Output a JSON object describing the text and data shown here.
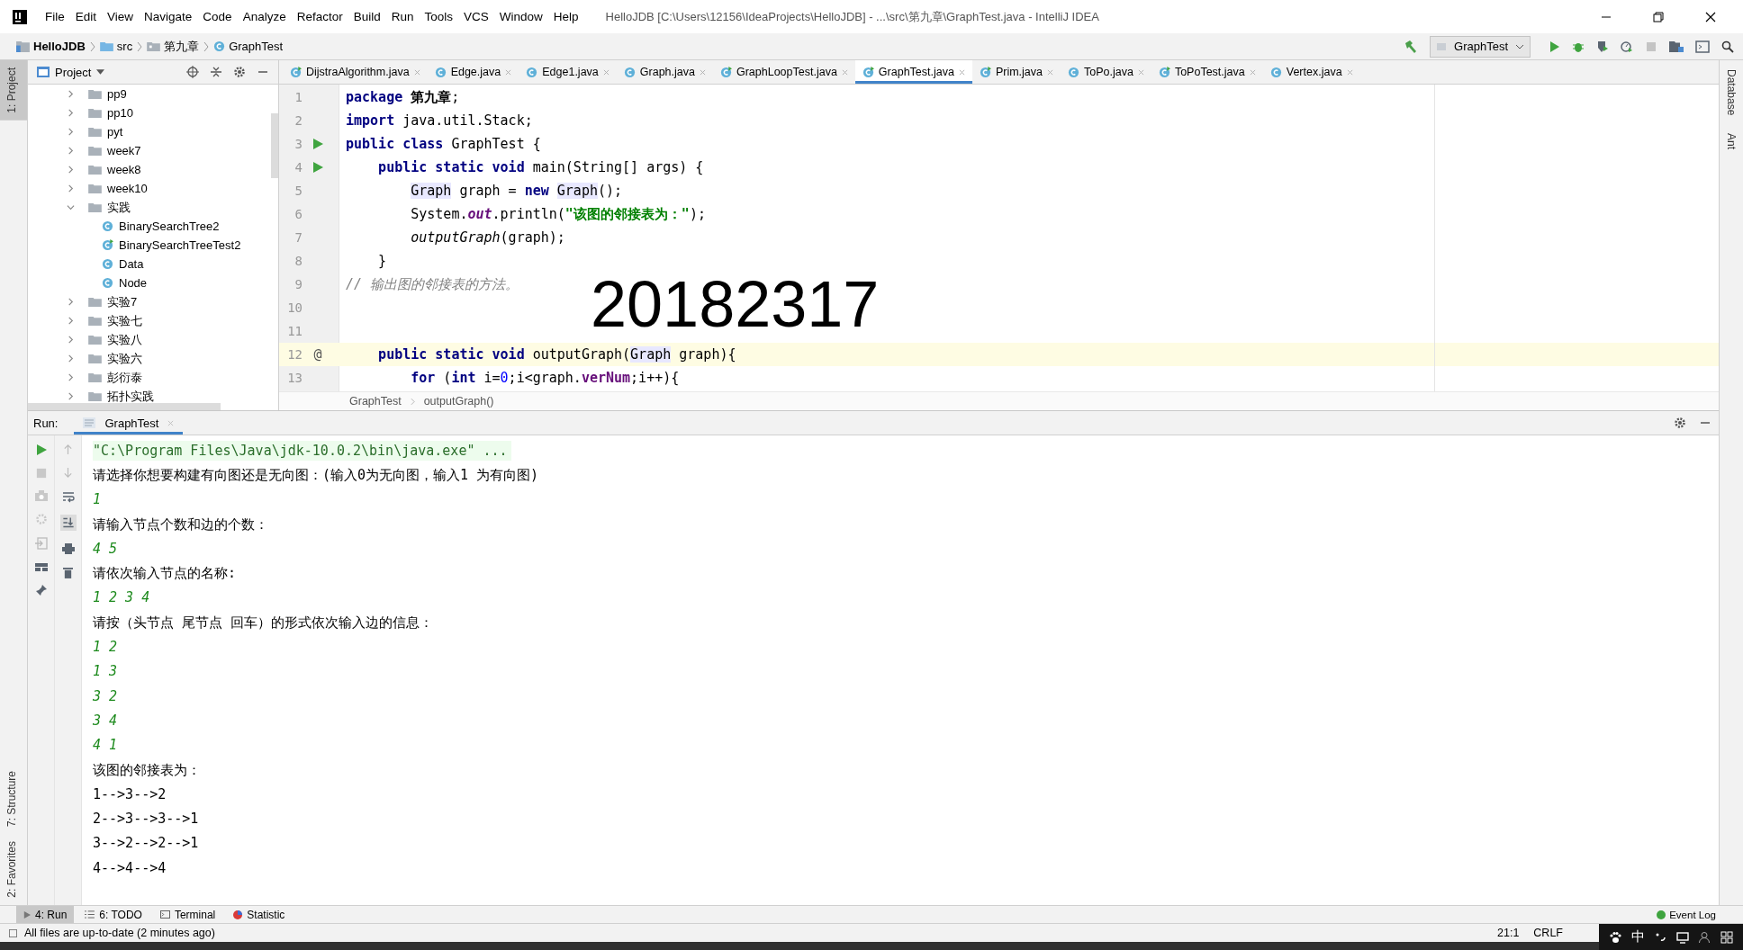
{
  "window": {
    "title": "HelloJDB [C:\\Users\\12156\\IdeaProjects\\HelloJDB] - ...\\src\\第九章\\GraphTest.java - IntelliJ IDEA"
  },
  "menu": [
    "File",
    "Edit",
    "View",
    "Navigate",
    "Code",
    "Analyze",
    "Refactor",
    "Build",
    "Run",
    "Tools",
    "VCS",
    "Window",
    "Help"
  ],
  "breadcrumb": [
    {
      "kind": "module",
      "label": "HelloJDB"
    },
    {
      "kind": "folder",
      "label": "src"
    },
    {
      "kind": "package",
      "label": "第九章"
    },
    {
      "kind": "class",
      "label": "GraphTest"
    }
  ],
  "run_config": "GraphTest",
  "left_top_tools": [
    {
      "label": "1: Project",
      "selected": true
    }
  ],
  "left_bottom_tools": [
    {
      "label": "7: Structure",
      "selected": false
    },
    {
      "label": "2: Favorites",
      "selected": false
    }
  ],
  "right_tools": [
    "Database",
    "Ant"
  ],
  "project": {
    "title": "Project",
    "tree": [
      {
        "label": "pp9",
        "kind": "folder",
        "expanded": false
      },
      {
        "label": "pp10",
        "kind": "folder",
        "expanded": false
      },
      {
        "label": "pyt",
        "kind": "folder",
        "expanded": false
      },
      {
        "label": "week7",
        "kind": "folder",
        "expanded": false
      },
      {
        "label": "week8",
        "kind": "folder",
        "expanded": false
      },
      {
        "label": "week10",
        "kind": "folder",
        "expanded": false
      },
      {
        "label": "实践",
        "kind": "folder",
        "expanded": true,
        "children": [
          {
            "label": "BinarySearchTree2",
            "kind": "class"
          },
          {
            "label": "BinarySearchTreeTest2",
            "kind": "test_class"
          },
          {
            "label": "Data",
            "kind": "class"
          },
          {
            "label": "Node",
            "kind": "class"
          }
        ]
      },
      {
        "label": "实验7",
        "kind": "folder",
        "expanded": false
      },
      {
        "label": "实验七",
        "kind": "folder",
        "expanded": false
      },
      {
        "label": "实验八",
        "kind": "folder",
        "expanded": false
      },
      {
        "label": "实验六",
        "kind": "folder",
        "expanded": false
      },
      {
        "label": "彭衍泰",
        "kind": "folder",
        "expanded": false
      },
      {
        "label": "拓扑实践",
        "kind": "folder",
        "expanded": false
      }
    ]
  },
  "editor_tabs": [
    {
      "label": "DijstraAlgorithm.java",
      "kind": "test_class",
      "selected": false
    },
    {
      "label": "Edge.java",
      "kind": "class",
      "selected": false
    },
    {
      "label": "Edge1.java",
      "kind": "class",
      "selected": false
    },
    {
      "label": "Graph.java",
      "kind": "class",
      "selected": false
    },
    {
      "label": "GraphLoopTest.java",
      "kind": "test_class",
      "selected": false
    },
    {
      "label": "GraphTest.java",
      "kind": "test_class",
      "selected": true
    },
    {
      "label": "Prim.java",
      "kind": "test_class",
      "selected": false
    },
    {
      "label": "ToPo.java",
      "kind": "class",
      "selected": false
    },
    {
      "label": "ToPoTest.java",
      "kind": "test_class",
      "selected": false
    },
    {
      "label": "Vertex.java",
      "kind": "class",
      "selected": false
    }
  ],
  "code": [
    {
      "number": "1",
      "kind": "top",
      "current": false,
      "segments": [
        {
          "kind": "kw",
          "text": "package "
        },
        {
          "kind": "bold",
          "text": "第九章"
        },
        {
          "kind": "plain",
          "text": ";"
        }
      ]
    },
    {
      "number": "2",
      "kind": "top",
      "current": false,
      "segments": [
        {
          "kind": "kw",
          "text": "import "
        },
        {
          "kind": "plain",
          "text": "java.util.Stack;"
        }
      ]
    },
    {
      "number": "3",
      "kind": "top",
      "current": false,
      "gutter": {
        "kind": "run"
      },
      "segments": [
        {
          "kind": "kw",
          "text": "public class "
        },
        {
          "kind": "plain",
          "text": "GraphTest {"
        }
      ]
    },
    {
      "number": "4",
      "kind": "member",
      "current": false,
      "gutter": {
        "kind": "run"
      },
      "segments": [
        {
          "kind": "kw",
          "text": "public static void "
        },
        {
          "kind": "plain",
          "text": "main(String[] args) {"
        }
      ]
    },
    {
      "number": "5",
      "kind": "statement",
      "current": false,
      "segments": [
        {
          "kind": "ref",
          "text": "Graph"
        },
        {
          "kind": "plain",
          "text": " graph = "
        },
        {
          "kind": "kw",
          "text": "new "
        },
        {
          "kind": "ref",
          "text": "Graph"
        },
        {
          "kind": "plain",
          "text": "();"
        }
      ]
    },
    {
      "number": "6",
      "kind": "statement",
      "current": false,
      "segments": [
        {
          "kind": "plain",
          "text": "System."
        },
        {
          "kind": "static",
          "text": "out"
        },
        {
          "kind": "plain",
          "text": ".println("
        },
        {
          "kind": "str",
          "text": "\"该图的邻接表为：\""
        },
        {
          "kind": "plain",
          "text": ");"
        }
      ]
    },
    {
      "number": "7",
      "kind": "statement",
      "current": false,
      "segments": [
        {
          "kind": "italic",
          "text": "outputGraph"
        },
        {
          "kind": "plain",
          "text": "(graph);"
        }
      ]
    },
    {
      "number": "8",
      "kind": "member",
      "current": false,
      "segments": [
        {
          "kind": "plain",
          "text": "}"
        }
      ]
    },
    {
      "number": "9",
      "kind": "top",
      "current": false,
      "segments": [
        {
          "kind": "comment",
          "text": "// 输出图的邻接表的方法。"
        }
      ]
    },
    {
      "number": "10",
      "current": false
    },
    {
      "number": "11",
      "current": false
    },
    {
      "number": "12",
      "kind": "member",
      "current": true,
      "gutter": {
        "kind": "override",
        "text": "@"
      },
      "segments": [
        {
          "kind": "kw",
          "text": "public static void "
        },
        {
          "kind": "plain",
          "text": "outputGraph("
        },
        {
          "kind": "ref",
          "text": "Graph"
        },
        {
          "kind": "plain",
          "text": " graph){"
        }
      ]
    },
    {
      "number": "13",
      "kind": "statement",
      "current": false,
      "segments": [
        {
          "kind": "kw",
          "text": "for "
        },
        {
          "kind": "plain",
          "text": "("
        },
        {
          "kind": "kw",
          "text": "int "
        },
        {
          "kind": "plain",
          "text": "i="
        },
        {
          "kind": "num",
          "text": "0"
        },
        {
          "kind": "plain",
          "text": ";i<graph."
        },
        {
          "kind": "field",
          "text": "verNum"
        },
        {
          "kind": "plain",
          "text": ";i++){"
        }
      ]
    }
  ],
  "overlay_text": "20182317",
  "editor_breadcrumb": [
    "GraphTest",
    "outputGraph()"
  ],
  "run": {
    "label": "Run:",
    "tab": "GraphTest",
    "console": [
      {
        "kind": "command",
        "text": "\"C:\\Program Files\\Java\\jdk-10.0.2\\bin\\java.exe\" ..."
      },
      {
        "kind": "output",
        "text": "请选择你想要构建有向图还是无向图：(输入0为无向图，输入1 为有向图)"
      },
      {
        "kind": "input",
        "text": "1"
      },
      {
        "kind": "output",
        "text": "请输入节点个数和边的个数："
      },
      {
        "kind": "input",
        "text": "4 5"
      },
      {
        "kind": "output",
        "text": "请依次输入节点的名称:"
      },
      {
        "kind": "input",
        "text": "1 2 3 4"
      },
      {
        "kind": "output",
        "text": "请按（头节点 尾节点 回车）的形式依次输入边的信息："
      },
      {
        "kind": "input",
        "text": "1 2"
      },
      {
        "kind": "input",
        "text": "1 3"
      },
      {
        "kind": "input",
        "text": "3 2"
      },
      {
        "kind": "input",
        "text": "3 4"
      },
      {
        "kind": "input",
        "text": "4 1"
      },
      {
        "kind": "output",
        "text": "该图的邻接表为："
      },
      {
        "kind": "output",
        "text": "1-->3-->2"
      },
      {
        "kind": "output",
        "text": "2-->3-->3-->1"
      },
      {
        "kind": "output",
        "text": "3-->2-->2-->1"
      },
      {
        "kind": "output",
        "text": "4-->4-->4"
      }
    ]
  },
  "bottom_tabs": [
    {
      "label": "4: Run",
      "kind": "run",
      "selected": true
    },
    {
      "label": "6: TODO",
      "kind": "todo",
      "selected": false
    },
    {
      "label": "Terminal",
      "kind": "terminal",
      "selected": false
    },
    {
      "label": "Statistic",
      "kind": "statistic",
      "selected": false
    }
  ],
  "event_log": "Event Log",
  "status": {
    "message": "All files are up-to-date (2 minutes ago)",
    "position": "21:1",
    "line_separator": "CRLF"
  },
  "tray": {
    "ime": "中"
  }
}
